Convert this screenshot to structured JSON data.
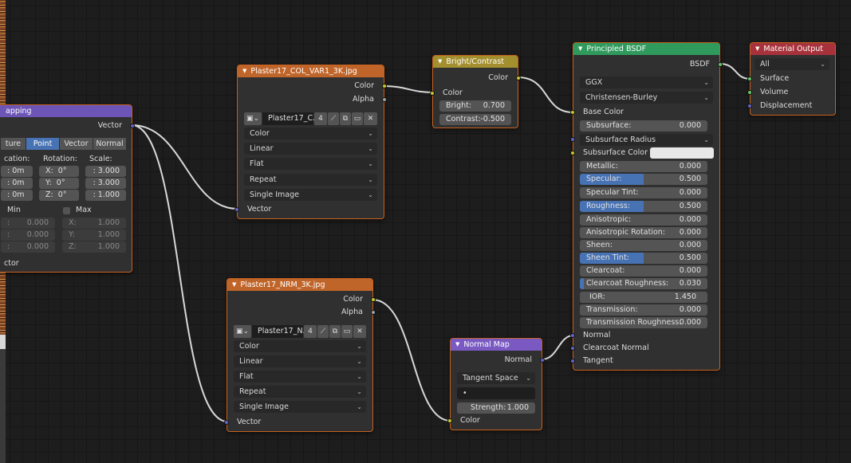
{
  "mapping_node": {
    "title": "apping",
    "output_vector": "Vector",
    "tabs": [
      "ture",
      "Point",
      "Vector",
      "Normal"
    ],
    "active_tab": "Point",
    "location_label": "cation:",
    "rotation_label": "Rotation:",
    "scale_label": "Scale:",
    "location": [
      ": 0m",
      ": 0m",
      ": 0m"
    ],
    "rotation": [
      {
        "axis": "X:",
        "value": "0°"
      },
      {
        "axis": "Y:",
        "value": "0°"
      },
      {
        "axis": "Z:",
        "value": "0°"
      }
    ],
    "scale": [
      ": 3.000",
      ": 3.000",
      ": 1.000"
    ],
    "min_label": "Min",
    "max_label": "Max",
    "min": [
      {
        "axis": ":",
        "value": "0.000"
      },
      {
        "axis": ":",
        "value": "0.000"
      },
      {
        "axis": ":",
        "value": "0.000"
      }
    ],
    "max": [
      {
        "axis": "X:",
        "value": "1.000"
      },
      {
        "axis": "Y:",
        "value": "1.000"
      },
      {
        "axis": "Z:",
        "value": "1.000"
      }
    ],
    "input_vector": "ctor",
    "header_color": "#6d55b8"
  },
  "image_node_col": {
    "title": "Plaster17_COL_VAR1_3K.jpg",
    "outputs": [
      "Color",
      "Alpha"
    ],
    "image_name": "Plaster17_C..",
    "users": "4",
    "color_space": "Color",
    "interpolation": "Linear",
    "projection": "Flat",
    "extension": "Repeat",
    "source": "Single Image",
    "input": "Vector",
    "header_color": "#c0652a"
  },
  "image_node_nrm": {
    "title": "Plaster17_NRM_3K.jpg",
    "outputs": [
      "Color",
      "Alpha"
    ],
    "image_name": "Plaster17_N..",
    "users": "4",
    "color_space": "Color",
    "interpolation": "Linear",
    "projection": "Flat",
    "extension": "Repeat",
    "source": "Single Image",
    "input": "Vector",
    "header_color": "#c0652a"
  },
  "bright_contrast_node": {
    "title": "Bright/Contrast",
    "output": "Color",
    "input": "Color",
    "bright_label": "Bright:",
    "bright_value": "0.700",
    "contrast_label": "Contrast:",
    "contrast_value": "-0.500",
    "header_color": "#a38f2d"
  },
  "normal_map_node": {
    "title": "Normal Map",
    "output": "Normal",
    "space": "Tangent Space",
    "uv_map": "",
    "strength_label": "Strength:",
    "strength_value": "1.000",
    "input": "Color",
    "header_color": "#7a5ac2"
  },
  "principled_node": {
    "title": "Principled BSDF",
    "output": "BSDF",
    "distribution": "GGX",
    "subsurface_method": "Christensen-Burley",
    "base_color_label": "Base Color",
    "subsurface_radius_label": "Subsurface Radius",
    "subsurface_color_label": "Subsurface Color",
    "subsurface_color_swatch": "#e8e8e8",
    "fields": [
      {
        "label": "Subsurface:",
        "value": "0.000",
        "fill": 0
      },
      {
        "label": "Metallic:",
        "value": "0.000",
        "fill": 0
      },
      {
        "label": "Specular:",
        "value": "0.500",
        "fill": 0.5
      },
      {
        "label": "Specular Tint:",
        "value": "0.000",
        "fill": 0
      },
      {
        "label": "Roughness:",
        "value": "0.500",
        "fill": 0.5
      },
      {
        "label": "Anisotropic:",
        "value": "0.000",
        "fill": 0
      },
      {
        "label": "Anisotropic Rotation:",
        "value": "0.000",
        "fill": 0
      },
      {
        "label": "Sheen:",
        "value": "0.000",
        "fill": 0
      },
      {
        "label": "Sheen Tint:",
        "value": "0.500",
        "fill": 0.5
      },
      {
        "label": "Clearcoat:",
        "value": "0.000",
        "fill": 0
      },
      {
        "label": "Clearcoat Roughness:",
        "value": "0.030",
        "fill": 0.03
      },
      {
        "label": "IOR:",
        "value": "1.450",
        "fill": 0
      },
      {
        "label": "Transmission:",
        "value": "0.000",
        "fill": 0
      },
      {
        "label": "Transmission Roughness:",
        "value": "0.000",
        "fill": 0
      }
    ],
    "normal_label": "Normal",
    "clearcoat_normal_label": "Clearcoat Normal",
    "tangent_label": "Tangent",
    "header_color": "#2f9a5c"
  },
  "material_output_node": {
    "title": "Material Output",
    "target": "All",
    "inputs": [
      "Surface",
      "Volume",
      "Displacement"
    ],
    "header_color": "#a8323c"
  },
  "colors": {
    "accent_blue": "#4772b3",
    "node_border_selected": "#c5611f",
    "socket_color": "#c7c729",
    "socket_shader": "#63c763",
    "socket_vector": "#6363c7",
    "socket_float": "#a1a1a1"
  }
}
